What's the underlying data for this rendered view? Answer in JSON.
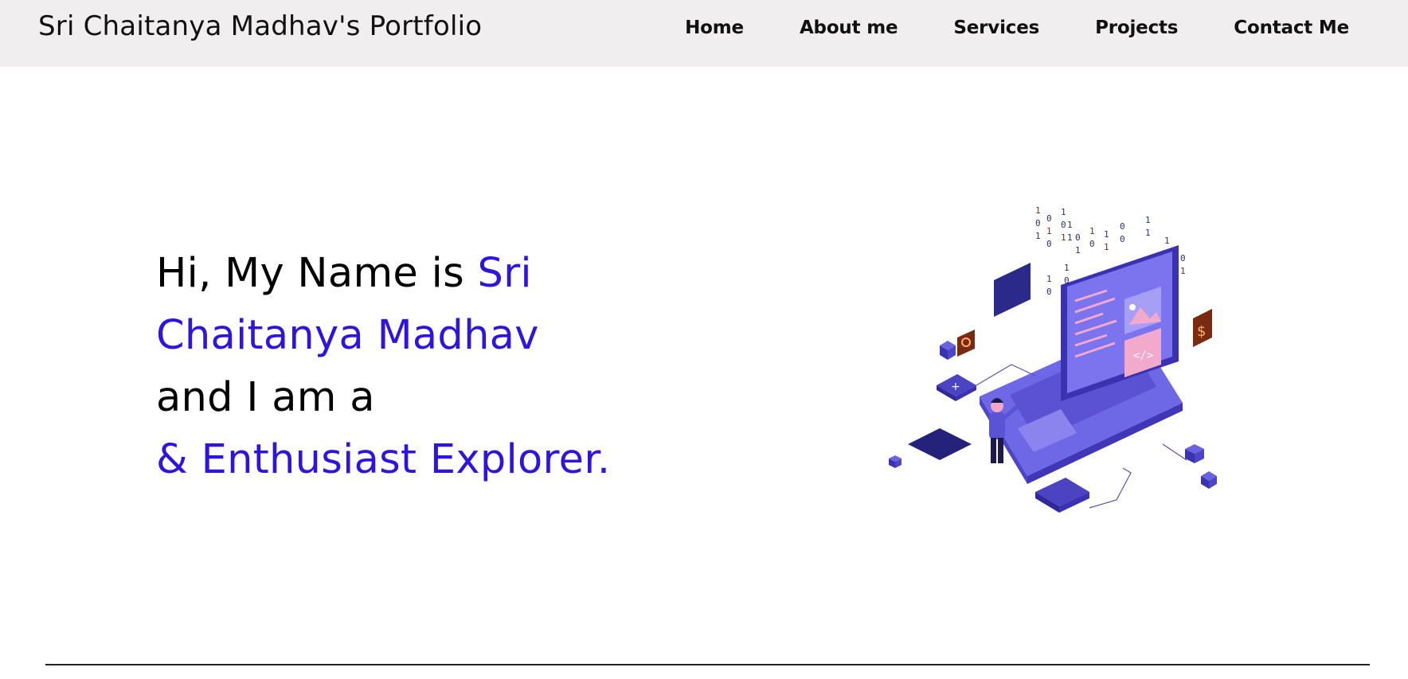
{
  "header": {
    "brand": "Sri Chaitanya Madhav's Portfolio",
    "nav": [
      {
        "label": "Home"
      },
      {
        "label": "About me"
      },
      {
        "label": "Services"
      },
      {
        "label": "Projects"
      },
      {
        "label": "Contact Me"
      }
    ]
  },
  "hero": {
    "intro": "Hi, My Name is ",
    "name_part1": "Sri",
    "name_part2": "Chaitanya Madhav",
    "role_prefix": "and I am a",
    "role_text": "& Enthusiast Explorer."
  },
  "illustration": {
    "icon": "laptop-developer-illustration-icon",
    "binary_digits": [
      "1",
      "0",
      "1",
      "1",
      "0",
      "1",
      "1",
      "0",
      "1",
      "1",
      "0",
      "0",
      "1",
      "1",
      "0",
      "1",
      "0",
      "1",
      "1",
      "0",
      "1",
      "0",
      "1",
      "0",
      "1",
      "1",
      "0",
      "0",
      "1",
      "0",
      "1"
    ]
  },
  "colors": {
    "accent": "#2d14e0",
    "navbar_bg": "#f0eeee",
    "illustration_primary": "#5b53d6",
    "illustration_dark": "#2b2a8a",
    "illustration_pink": "#f0a6c8",
    "illustration_brown": "#7a2a10"
  }
}
